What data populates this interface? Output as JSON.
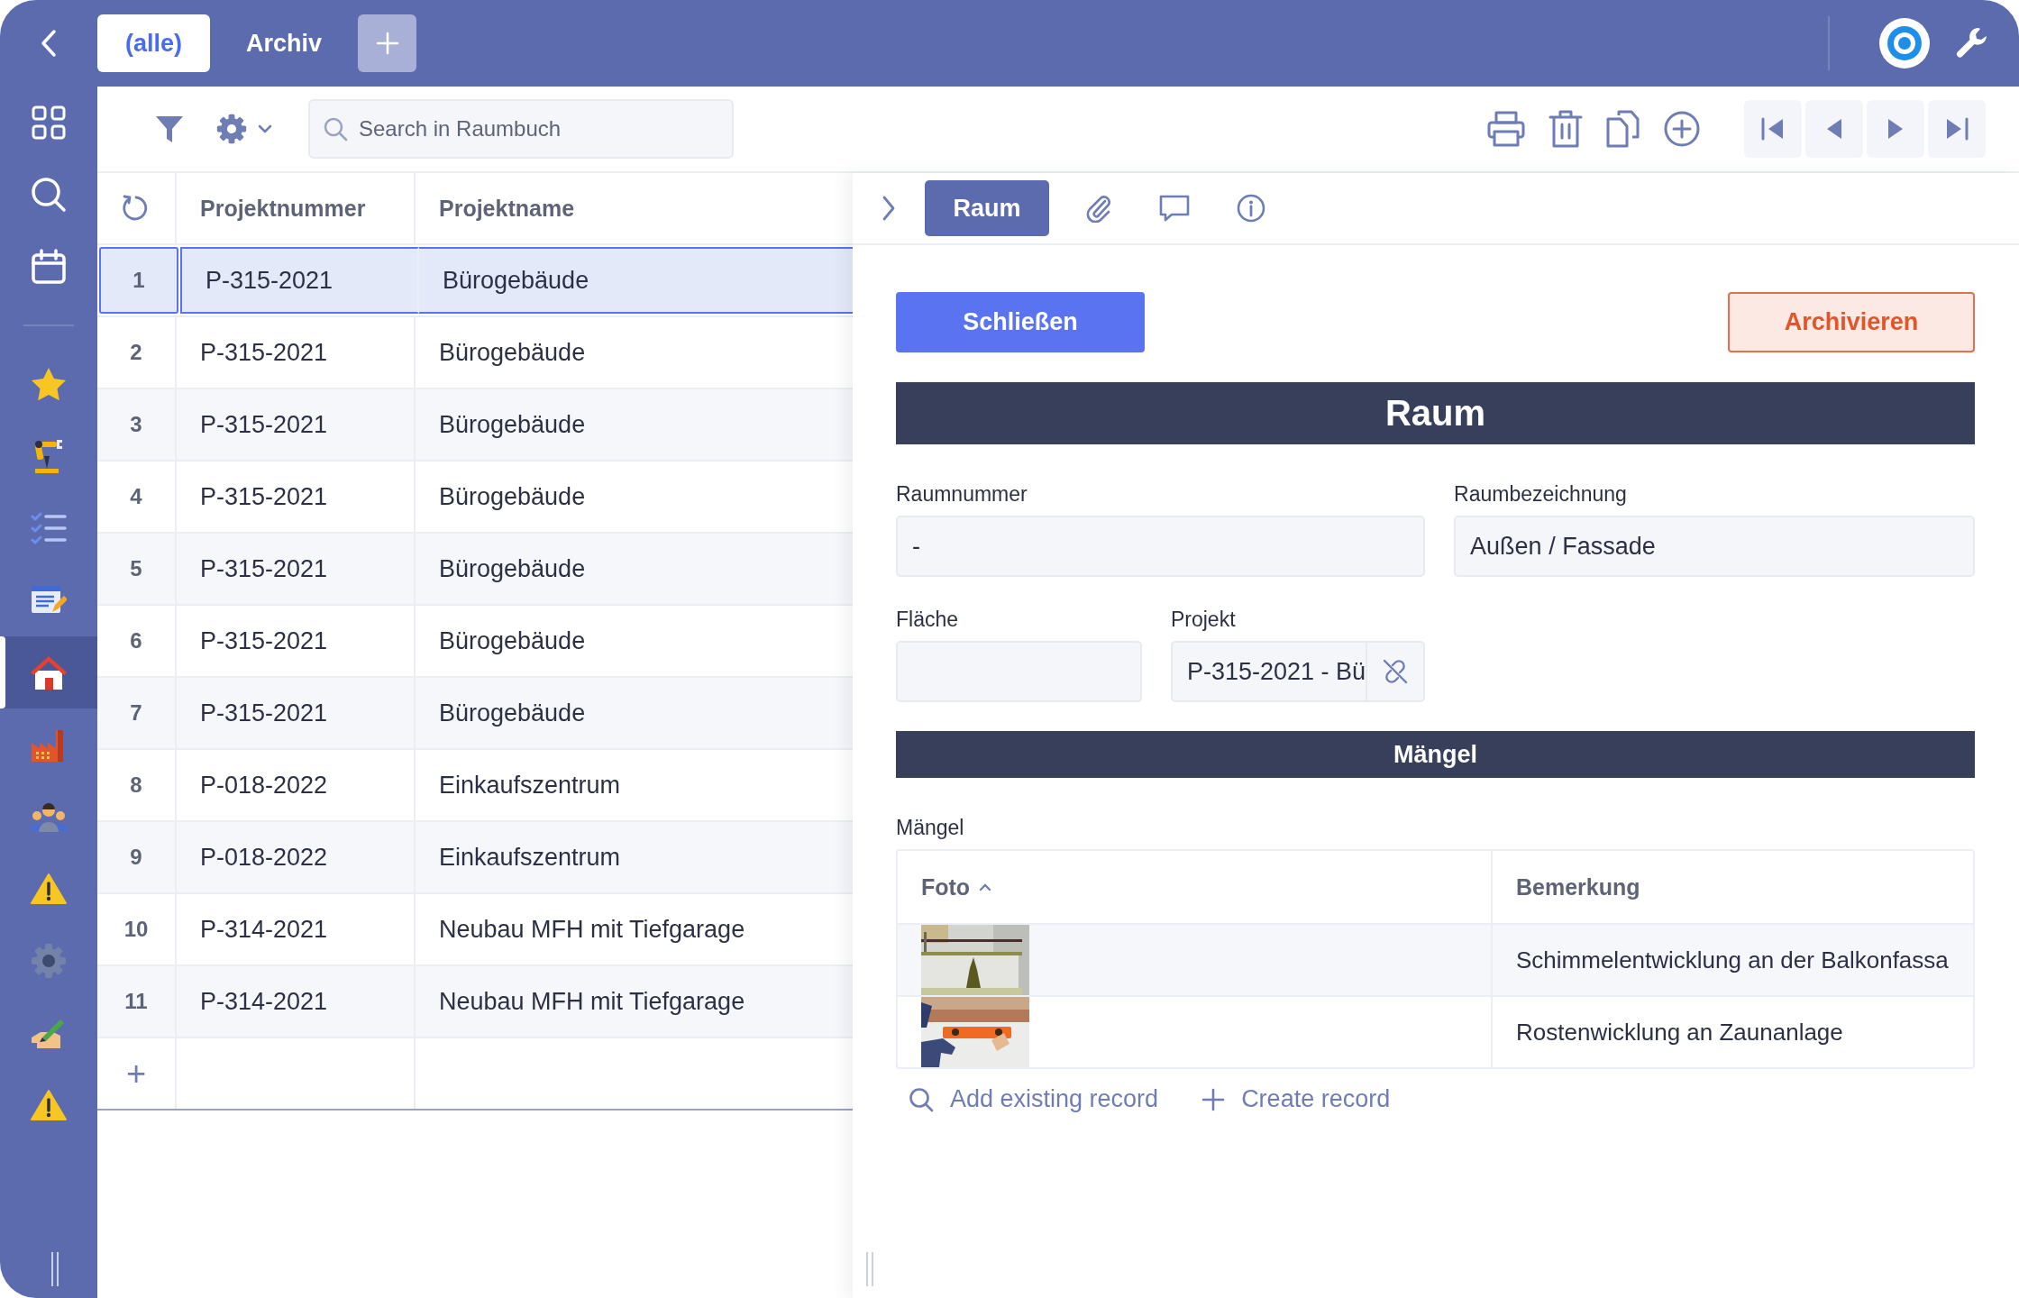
{
  "tabs": [
    {
      "label": "(alle)",
      "selected": true
    },
    {
      "label": "Archiv",
      "selected": false
    }
  ],
  "sidebar": {
    "items": [
      {
        "selected": false
      },
      {
        "selected": false
      },
      {
        "selected": false
      },
      {
        "selected": false
      },
      {
        "selected": false
      },
      {
        "selected": false
      },
      {
        "selected": false
      },
      {
        "selected": true
      },
      {
        "selected": false
      },
      {
        "selected": false
      },
      {
        "selected": false
      },
      {
        "selected": false
      },
      {
        "selected": false
      },
      {
        "selected": false
      }
    ]
  },
  "toolbar": {
    "search": {
      "placeholder": "Search in Raumbuch"
    }
  },
  "table": {
    "columns": [
      "Projektnummer",
      "Projektname"
    ],
    "add_row": "+",
    "rows": [
      {
        "number": "1",
        "projektnummer": "P-315-2021",
        "projektname": "Bürogebäude",
        "selected": true
      },
      {
        "number": "2",
        "projektnummer": "P-315-2021",
        "projektname": "Bürogebäude",
        "selected": false
      },
      {
        "number": "3",
        "projektnummer": "P-315-2021",
        "projektname": "Bürogebäude",
        "selected": false
      },
      {
        "number": "4",
        "projektnummer": "P-315-2021",
        "projektname": "Bürogebäude",
        "selected": false
      },
      {
        "number": "5",
        "projektnummer": "P-315-2021",
        "projektname": "Bürogebäude",
        "selected": false
      },
      {
        "number": "6",
        "projektnummer": "P-315-2021",
        "projektname": "Bürogebäude",
        "selected": false
      },
      {
        "number": "7",
        "projektnummer": "P-315-2021",
        "projektname": "Bürogebäude",
        "selected": false
      },
      {
        "number": "8",
        "projektnummer": "P-018-2022",
        "projektname": "Einkaufszentrum",
        "selected": false
      },
      {
        "number": "9",
        "projektnummer": "P-018-2022",
        "projektname": "Einkaufszentrum",
        "selected": false
      },
      {
        "number": "10",
        "projektnummer": "P-314-2021",
        "projektname": "Neubau MFH mit Tiefgarage",
        "selected": false
      },
      {
        "number": "11",
        "projektnummer": "P-314-2021",
        "projektname": "Neubau MFH mit Tiefgarage",
        "selected": false
      }
    ]
  },
  "detail": {
    "tabs": [
      {
        "label": "Raum",
        "selected": true
      }
    ],
    "buttons": {
      "close": "Schließen",
      "archive": "Archivieren"
    },
    "section_title": "Raum",
    "fields": [
      {
        "label": "Raumnummer",
        "value": "-",
        "kind": "text"
      },
      {
        "label": "Raumbezeichnung",
        "value": "Außen / Fassade",
        "kind": "text"
      },
      {
        "label": "Fläche",
        "kind": "text"
      },
      {
        "label": "Projekt",
        "value": "P-315-2021 - Bü",
        "kind": "link"
      }
    ],
    "subsection_title": "Mängel",
    "subtable": {
      "label": "Mängel",
      "columns": [
        {
          "label": "Foto",
          "sorted": true
        },
        {
          "label": "Bemerkung",
          "sorted": false
        }
      ],
      "rows": [
        {
          "bemerkung": "Schimmelentwicklung an der Balkonfassa"
        },
        {
          "bemerkung": "Rostenwicklung an Zaunanlage"
        }
      ]
    },
    "actions": [
      {
        "label": "Add existing record",
        "kind": "search"
      },
      {
        "label": "Create record",
        "kind": "create"
      }
    ]
  }
}
